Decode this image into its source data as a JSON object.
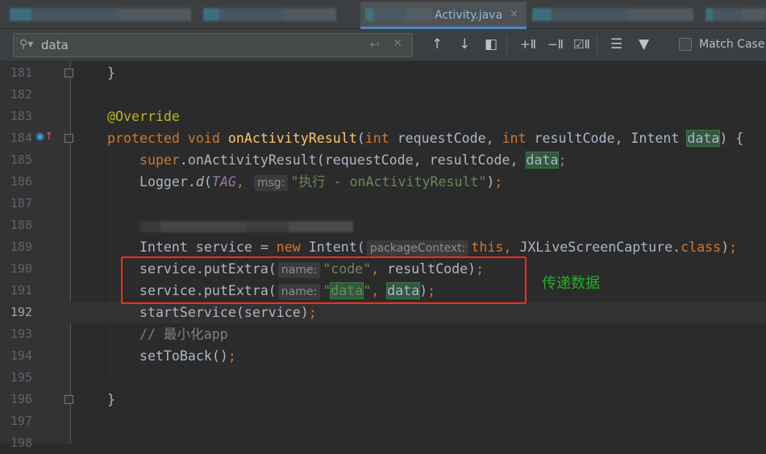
{
  "tabs": {
    "active": "Activity.java",
    "close": "×"
  },
  "find": {
    "query": "data",
    "match_case_label": "Match Case",
    "match_case_checked": false,
    "icons": [
      "search-icon",
      "regex-history-icon",
      "clear-icon",
      "previous-occurrence-icon",
      "next-occurrence-icon",
      "select-all-icon",
      "add-selection-icon",
      "remove-selection-icon",
      "toggle-selection-icon",
      "filter-lines-icon",
      "filter-icon"
    ]
  },
  "current_line": 192,
  "lines": [
    {
      "n": 181,
      "t": [
        [
          "t",
          "}"
        ]
      ]
    },
    {
      "n": 182,
      "t": []
    },
    {
      "n": 183,
      "t": [
        [
          "a",
          "@Override"
        ]
      ]
    },
    {
      "n": 184,
      "t": [
        [
          "k",
          "protected void "
        ],
        [
          "m",
          "onActivityResult"
        ],
        [
          "t",
          "("
        ],
        [
          "k",
          "int "
        ],
        [
          "t",
          "requestCode, "
        ],
        [
          "k",
          "int "
        ],
        [
          "t",
          "resultCode, Intent "
        ],
        [
          "f",
          "data"
        ],
        [
          "t",
          ") {"
        ]
      ]
    },
    {
      "n": 185,
      "t": [
        [
          "t",
          "    "
        ],
        [
          "k",
          "super"
        ],
        [
          "t",
          ".onActivityResult(requestCode, resultCode, "
        ],
        [
          "f",
          "data"
        ],
        [
          "k",
          ";"
        ]
      ]
    },
    {
      "n": 186,
      "t": [
        [
          "t",
          "    Logger."
        ],
        [
          "i",
          "d"
        ],
        [
          "t",
          "("
        ],
        [
          "p",
          "TAG"
        ],
        [
          "k",
          ", "
        ],
        [
          "h",
          "msg:"
        ],
        [
          "s",
          "\"执行 - onActivityResult\""
        ],
        [
          "t",
          ")"
        ],
        [
          "k",
          ";"
        ]
      ]
    },
    {
      "n": 187,
      "t": []
    },
    {
      "n": 188,
      "t": [
        [
          "t",
          "    "
        ],
        [
          "b",
          ""
        ]
      ]
    },
    {
      "n": 189,
      "t": [
        [
          "t",
          "    Intent service = "
        ],
        [
          "k",
          "new "
        ],
        [
          "t",
          "Intent("
        ],
        [
          "h",
          "packageContext:"
        ],
        [
          "k",
          "this, "
        ],
        [
          "t",
          "JXLiveScreenCapture."
        ],
        [
          "k",
          "class"
        ],
        [
          "t",
          ")"
        ],
        [
          "k",
          ";"
        ]
      ]
    },
    {
      "n": 190,
      "t": [
        [
          "t",
          "    service.putExtra("
        ],
        [
          "h",
          "name:"
        ],
        [
          "s",
          "\"code\""
        ],
        [
          "k",
          ", "
        ],
        [
          "t",
          "resultCode)"
        ],
        [
          "k",
          ";"
        ]
      ]
    },
    {
      "n": 191,
      "t": [
        [
          "t",
          "    service.putExtra("
        ],
        [
          "h",
          "name:"
        ],
        [
          "s",
          "\""
        ],
        [
          "fs",
          "data"
        ],
        [
          "s",
          "\""
        ],
        [
          "k",
          ", "
        ],
        [
          "f",
          "data"
        ],
        [
          "t",
          ")"
        ],
        [
          "k",
          ";"
        ]
      ]
    },
    {
      "n": 192,
      "t": [
        [
          "t",
          "    startService(service)"
        ],
        [
          "k",
          ";"
        ]
      ]
    },
    {
      "n": 193,
      "t": [
        [
          "c",
          "    // 最小化app"
        ]
      ]
    },
    {
      "n": 194,
      "t": [
        [
          "t",
          "    setToBack()"
        ],
        [
          "k",
          ";"
        ]
      ]
    },
    {
      "n": 195,
      "t": []
    },
    {
      "n": 196,
      "t": [
        [
          "t",
          "}"
        ]
      ]
    },
    {
      "n": 197,
      "t": []
    },
    {
      "n": 198,
      "t": []
    }
  ],
  "annotation": {
    "text": "传递数据",
    "color": "#22b022",
    "box_color": "#ff2a1a"
  }
}
